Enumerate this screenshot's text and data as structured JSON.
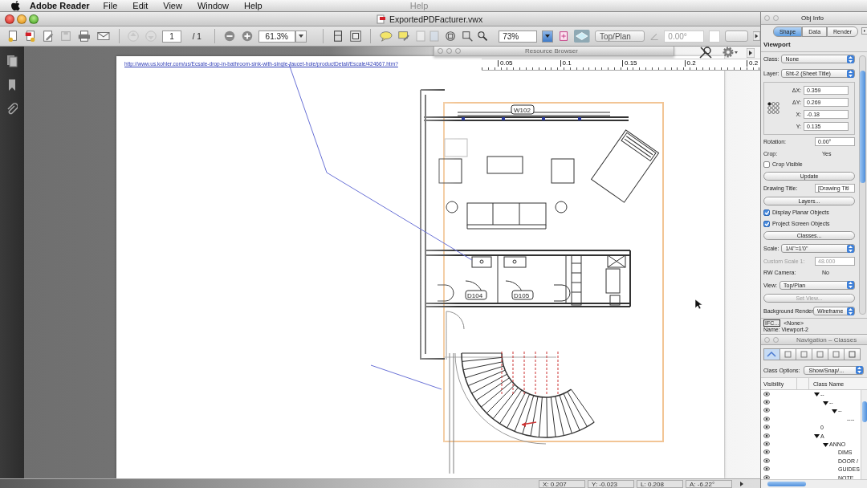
{
  "menu_bar": {
    "app": "Adobe Reader",
    "items": [
      "File",
      "Edit",
      "View",
      "Window",
      "Help"
    ],
    "ghost_items": [
      "Help"
    ]
  },
  "window": {
    "title": "ExportedPDFacturer.vwx"
  },
  "toolbar": {
    "page": "1",
    "page_count": "/ 1",
    "zoom": "61.3%",
    "layer_zoom": "73%",
    "view": "Top/Plan",
    "rotation": "0.00°"
  },
  "resource_browser": {
    "title": "Resource Browser"
  },
  "document": {
    "link": "http://www.us.kohler.com/us/Ecsale-drop-in-bathroom-sink-with-single-faucet-hole/productDetail/Escale/424667.htm?",
    "ruler_labels": [
      "0.05",
      "0.1",
      "0.15",
      "0.2",
      "0.2"
    ],
    "plan_labels": [
      "W102",
      "D104",
      "D105"
    ]
  },
  "obj_info": {
    "title": "Obj Info",
    "tabs": [
      {
        "label": "Shape",
        "selected": true
      },
      {
        "label": "Data",
        "selected": false
      },
      {
        "label": "Render",
        "selected": false
      }
    ],
    "heading": "Viewport",
    "rows": [
      {
        "kind": "select",
        "label": "Class:",
        "value": "None",
        "disabled": false
      },
      {
        "kind": "select",
        "label": "Layer:",
        "value": "Sht-2 (Sheet Title)",
        "disabled": false
      },
      {
        "kind": "coords",
        "items": [
          {
            "label": "ΔX:",
            "value": "0.359"
          },
          {
            "label": "ΔY:",
            "value": "0.269"
          },
          {
            "label": "X:",
            "value": "-0.18"
          },
          {
            "label": "Y:",
            "value": "0.135"
          }
        ]
      },
      {
        "kind": "field",
        "label": "Rotation:",
        "value": "0.00°",
        "disabled": false
      },
      {
        "kind": "info",
        "label": "Crop:",
        "value": "Yes",
        "disabled": false
      },
      {
        "kind": "checkbox",
        "label": "Crop Visible",
        "checked": false,
        "disabled": false
      },
      {
        "kind": "button",
        "label": "Update",
        "disabled": false
      },
      {
        "kind": "field",
        "label": "Drawing Title:",
        "value": "[Drawing Titl",
        "disabled": false
      },
      {
        "kind": "button",
        "label": "Layers...",
        "disabled": false
      },
      {
        "kind": "checkbox",
        "label": "Display Planar Objects",
        "checked": true,
        "disabled": false
      },
      {
        "kind": "checkbox",
        "label": "Project Screen Objects",
        "checked": true,
        "disabled": false
      },
      {
        "kind": "button",
        "label": "Classes...",
        "disabled": false
      },
      {
        "kind": "select",
        "label": "Scale:",
        "value": "1/4\"=1'0\"",
        "disabled": false
      },
      {
        "kind": "field",
        "label": "Custom Scale 1:",
        "value": "48.000",
        "disabled": true
      },
      {
        "kind": "info",
        "label": "RW Camera:",
        "value": "No",
        "disabled": false
      },
      {
        "kind": "select",
        "label": "View:",
        "value": "Top/Plan",
        "disabled": false
      },
      {
        "kind": "button",
        "label": "Set View...",
        "disabled": true
      },
      {
        "kind": "select",
        "label": "Background Render:",
        "value": "Wireframe",
        "disabled": false
      }
    ],
    "ifc": {
      "button": "IFC...",
      "value": "<None>",
      "name": "Name: Viewport-2"
    }
  },
  "navigation": {
    "title": "Navigation – Classes",
    "class_options": {
      "label": "Class Options:",
      "value": "Show/Snap/..."
    },
    "columns": [
      "Visibility",
      "Class Name"
    ],
    "classes": [
      {
        "name": "--",
        "expanded": true,
        "children": [
          {
            "name": "--",
            "expanded": true,
            "children": [
              {
                "name": "--",
                "expanded": true,
                "children": [
                  {
                    "name": "----"
                  }
                ]
              }
            ]
          }
        ]
      },
      {
        "name": "0"
      },
      {
        "name": "A",
        "expanded": true,
        "children": [
          {
            "name": "ANNO",
            "expanded": true,
            "children": [
              {
                "name": "DIMS"
              },
              {
                "name": "DOOR /"
              },
              {
                "name": "GUIDES"
              },
              {
                "name": "NOTE"
              }
            ]
          }
        ]
      }
    ]
  },
  "status_bar": [
    "X: 0.207",
    "Y: -0.023",
    "L: 0.208",
    "A: -6.22°"
  ]
}
